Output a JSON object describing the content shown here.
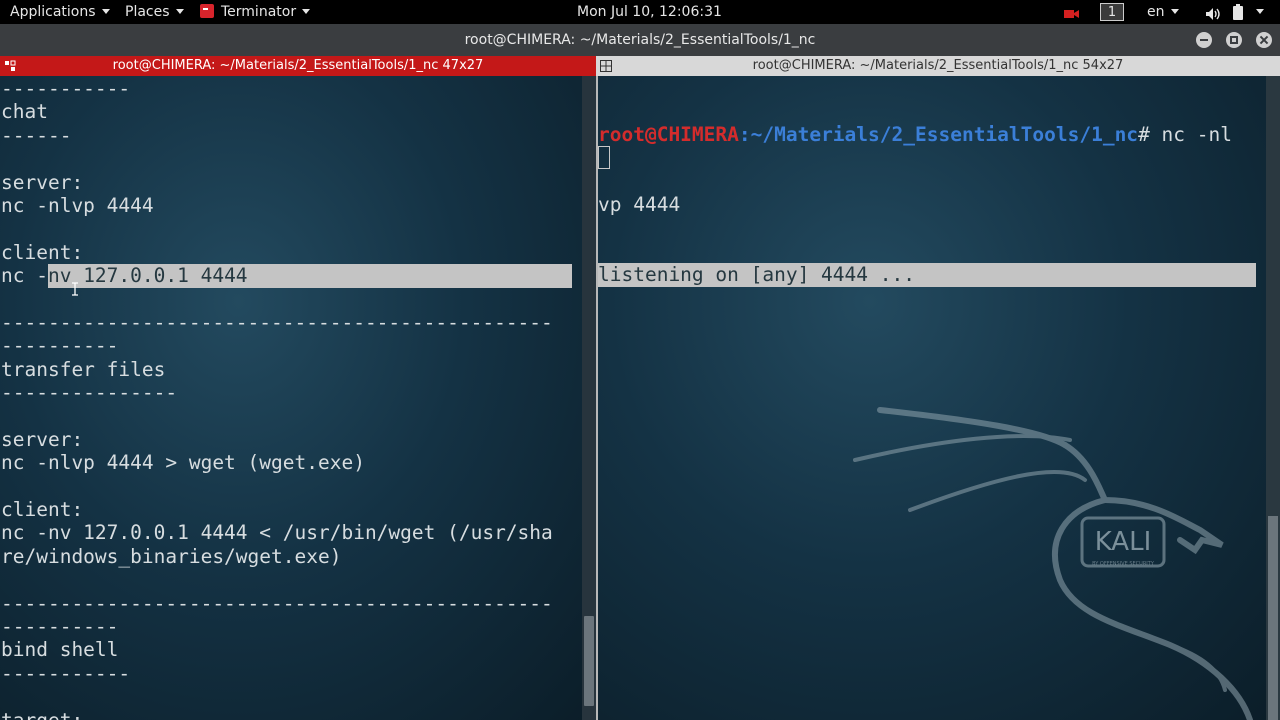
{
  "topbar": {
    "applications": "Applications",
    "places": "Places",
    "terminator": "Terminator",
    "clock": "Mon Jul 10, 12:06:31",
    "workspace": "1",
    "language": "en"
  },
  "window": {
    "title": "root@CHIMERA: ~/Materials/2_EssentialTools/1_nc"
  },
  "left_pane": {
    "title": "root@CHIMERA: ~/Materials/2_EssentialTools/1_nc 47x27",
    "lines": [
      "-----------",
      "chat",
      "------",
      "",
      "server:",
      "nc -nlvp 4444",
      "",
      "client:",
      "nc -",
      "",
      "-----------------------------------------------",
      "----------",
      "transfer files",
      "---------------",
      "",
      "server:",
      "nc -nlvp 4444 > wget (wget.exe)",
      "",
      "client:",
      "nc -nv 127.0.0.1 4444 < /usr/bin/wget (/usr/sha",
      "re/windows_binaries/wget.exe)",
      "",
      "-----------------------------------------------",
      "----------",
      "bind shell",
      "-----------",
      "",
      "target:"
    ],
    "selected_text": "nv 127.0.0.1 4444"
  },
  "right_pane": {
    "title": "root@CHIMERA: ~/Materials/2_EssentialTools/1_nc 54x27",
    "prompt_user": "root@CHIMERA",
    "prompt_path": ":~/Materials/2_EssentialTools/1_nc",
    "prompt_cmd": "# nc -nl",
    "cmd_wrap": "vp 4444",
    "output": "listening on [any] 4444 ..."
  },
  "wallpaper": {
    "logo_text": "KALI",
    "logo_subtext": "BY OFFENSIVE SECURITY"
  },
  "colors": {
    "active_pane_title": "#c41818",
    "prompt_user": "#d42c2c",
    "prompt_path": "#3b7fd8",
    "selection": "#c4c4c4"
  }
}
